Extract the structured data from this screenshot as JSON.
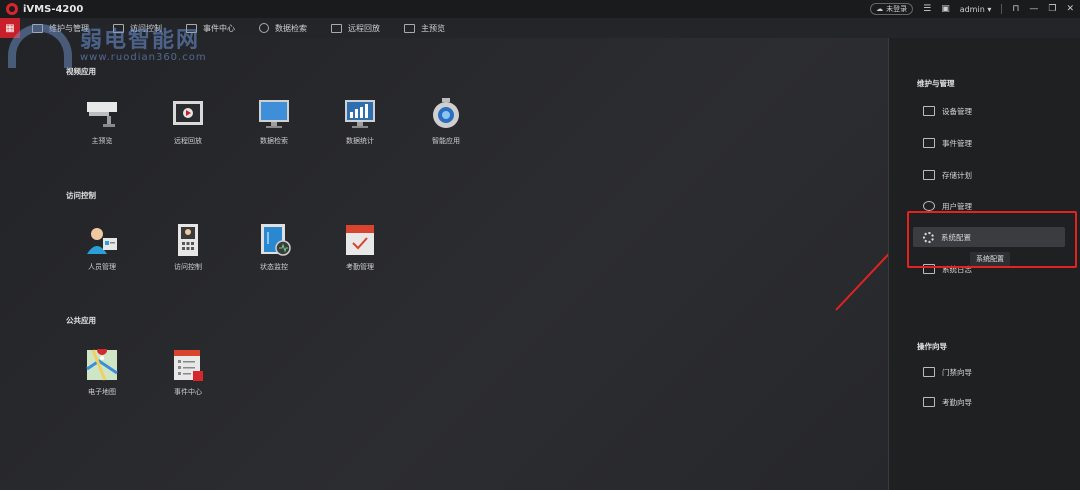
{
  "titlebar": {
    "app_title": "iVMS-4200",
    "login_label": "未登录",
    "user_label": "admin"
  },
  "menubar": {
    "tabs": [
      {
        "label": "维护与管理"
      },
      {
        "label": "访问控制"
      },
      {
        "label": "事件中心"
      },
      {
        "label": "数据检索"
      },
      {
        "label": "远程回放"
      },
      {
        "label": "主预览"
      }
    ]
  },
  "watermark": {
    "text": "弱电智能网",
    "url": "www.ruodian360.com"
  },
  "sections": [
    {
      "title": "视频应用",
      "items": [
        {
          "label": "主预览",
          "icon": "camera-icon"
        },
        {
          "label": "远程回放",
          "icon": "playback-icon"
        },
        {
          "label": "数据检索",
          "icon": "monitor-search-icon"
        },
        {
          "label": "数据统计",
          "icon": "statistics-icon"
        },
        {
          "label": "智能应用",
          "icon": "robot-camera-icon"
        }
      ]
    },
    {
      "title": "访问控制",
      "items": [
        {
          "label": "人员管理",
          "icon": "person-card-icon"
        },
        {
          "label": "访问控制",
          "icon": "access-terminal-icon"
        },
        {
          "label": "状态监控",
          "icon": "door-status-icon"
        },
        {
          "label": "考勤管理",
          "icon": "attendance-calendar-icon"
        }
      ]
    },
    {
      "title": "公共应用",
      "items": [
        {
          "label": "电子地图",
          "icon": "map-icon"
        },
        {
          "label": "事件中心",
          "icon": "event-list-icon"
        }
      ]
    }
  ],
  "right_panel": {
    "maint_title": "维护与管理",
    "maint_items": [
      {
        "label": "设备管理",
        "icon": "device-icon"
      },
      {
        "label": "事件管理",
        "icon": "event-icon"
      },
      {
        "label": "存储计划",
        "icon": "storage-icon"
      },
      {
        "label": "用户管理",
        "icon": "user-icon"
      },
      {
        "label": "系统配置",
        "icon": "gear-icon"
      },
      {
        "label": "系统日志",
        "icon": "log-icon"
      }
    ],
    "guide_title": "操作向导",
    "guide_items": [
      {
        "label": "门禁向导",
        "icon": "door-guide-icon"
      },
      {
        "label": "考勤向导",
        "icon": "attendance-guide-icon"
      }
    ],
    "tooltip": "系统配置"
  },
  "colors": {
    "accent": "#c8202a",
    "highlight": "#e32222"
  }
}
